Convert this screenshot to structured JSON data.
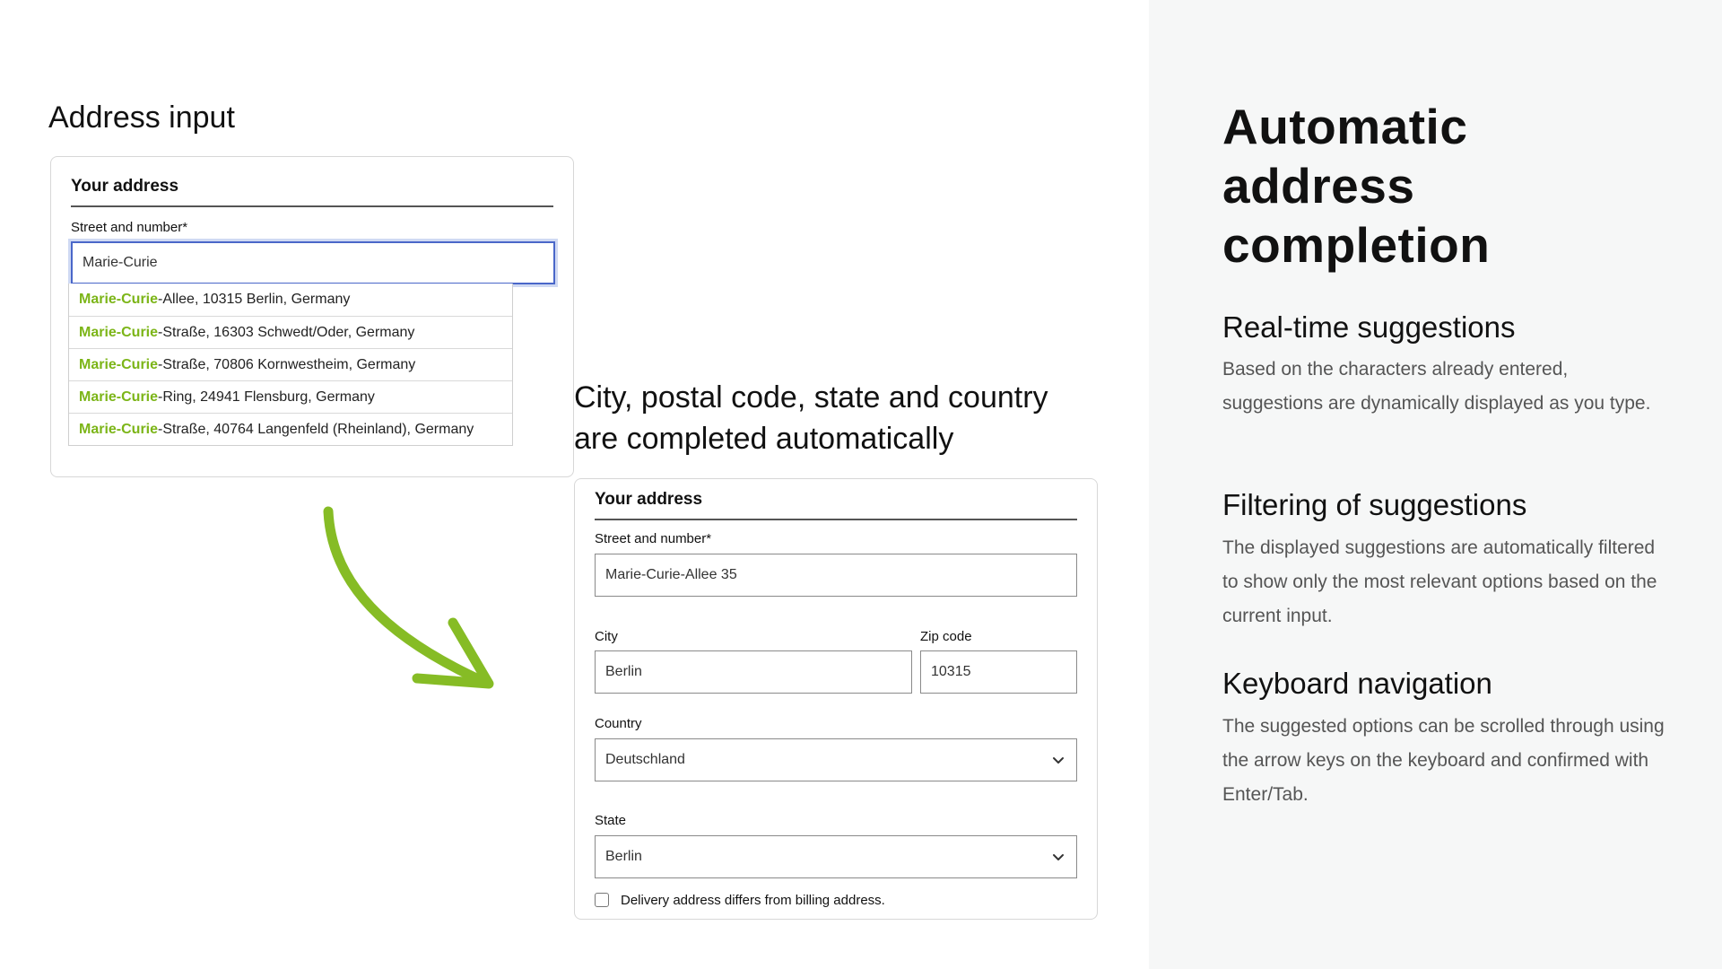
{
  "left": {
    "heading": "Address input",
    "card": {
      "title": "Your address",
      "street_label": "Street and number*",
      "street_value": "Marie-Curie",
      "suggestions": [
        {
          "match": "Marie-Curie",
          "rest": "-Allee, 10315 Berlin, Germany"
        },
        {
          "match": "Marie-Curie",
          "rest": "-Straße, 16303 Schwedt/Oder, Germany"
        },
        {
          "match": "Marie-Curie",
          "rest": "-Straße, 70806 Kornwestheim, Germany"
        },
        {
          "match": "Marie-Curie",
          "rest": "-Ring, 24941 Flensburg, Germany"
        },
        {
          "match": "Marie-Curie",
          "rest": "-Straße, 40764 Langenfeld (Rheinland), Germany"
        }
      ]
    }
  },
  "middle": {
    "caption_line1": "City, postal code, state and country",
    "caption_line2": "are completed automatically",
    "card": {
      "title": "Your address",
      "street_label": "Street and number*",
      "street_value": "Marie-Curie-Allee 35",
      "city_label": "City",
      "city_value": "Berlin",
      "zip_label": "Zip code",
      "zip_value": "10315",
      "country_label": "Country",
      "country_value": "Deutschland",
      "state_label": "State",
      "state_value": "Berlin",
      "checkbox_label": "Delivery address differs from billing address.",
      "checkbox_checked": false
    }
  },
  "right": {
    "title_line1": "Automatic",
    "title_line2": "address",
    "title_line3": "completion",
    "features": [
      {
        "title": "Real-time suggestions",
        "text": "Based on the characters already entered, suggestions are dynamically displayed as you type."
      },
      {
        "title": "Filtering of suggestions",
        "text": "The displayed suggestions are automatically filtered to show only the most relevant options based on the current input."
      },
      {
        "title": "Keyboard navigation",
        "text": "The suggested options can be scrolled through using the arrow keys on the keyboard and confirmed with Enter/Tab."
      }
    ]
  },
  "colors": {
    "highlight": "#7cb518",
    "arrow": "#86bc25",
    "focus": "#4a67c9",
    "panel_bg": "#f6f7f7"
  },
  "icons": {
    "arrow": "curved-arrow-icon",
    "select": "chevron-down-icon"
  }
}
